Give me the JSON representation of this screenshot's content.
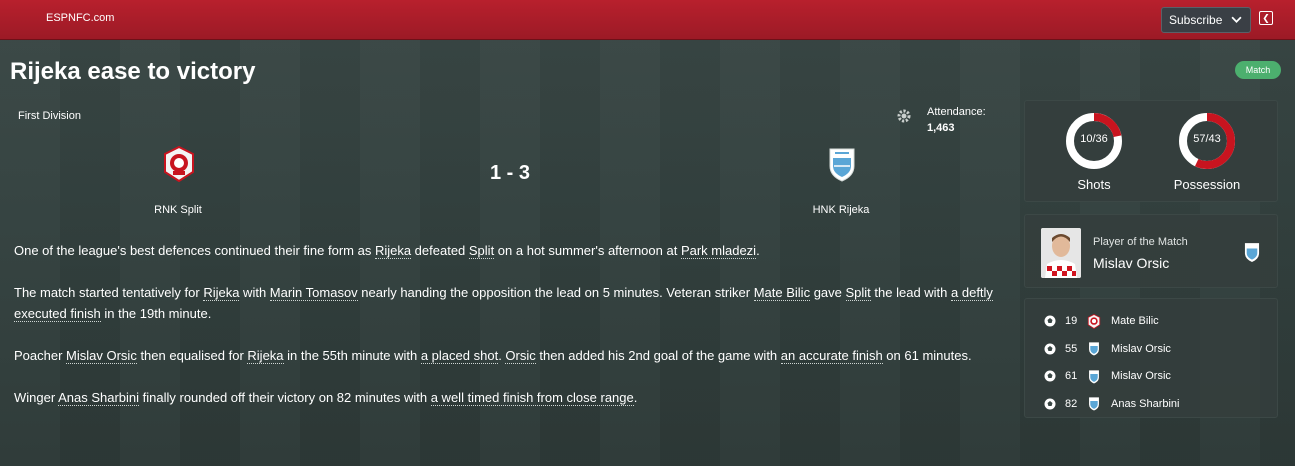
{
  "header": {
    "brand": "ESPNFC.com",
    "subscribe_label": "Subscribe"
  },
  "article": {
    "headline": "Rijeka ease to victory",
    "tag": "Match"
  },
  "match": {
    "competition": "First Division",
    "attendance_label": "Attendance:",
    "attendance": "1,463",
    "home_team": "RNK Split",
    "away_team": "HNK Rijeka",
    "score": "1 - 3"
  },
  "report": {
    "p1": [
      {
        "t": "One of the league's best defences continued their fine form as "
      },
      {
        "t": "Rijeka",
        "link": true
      },
      {
        "t": " defeated "
      },
      {
        "t": "Split",
        "link": true
      },
      {
        "t": " on a hot summer's afternoon at "
      },
      {
        "t": "Park mladezi",
        "link": true
      },
      {
        "t": "."
      }
    ],
    "p2": [
      {
        "t": "The match started tentatively for "
      },
      {
        "t": "Rijeka",
        "link": true
      },
      {
        "t": " with "
      },
      {
        "t": "Marin Tomasov",
        "link": true
      },
      {
        "t": " nearly handing the opposition the lead on 5 minutes. Veteran striker "
      },
      {
        "t": "Mate Bilic",
        "link": true
      },
      {
        "t": " gave "
      },
      {
        "t": "Split",
        "link": true
      },
      {
        "t": " the lead with "
      },
      {
        "t": "a deftly executed finish",
        "link": true
      },
      {
        "t": " in the 19th minute."
      }
    ],
    "p3": [
      {
        "t": "Poacher "
      },
      {
        "t": "Mislav Orsic",
        "link": true
      },
      {
        "t": " then equalised for "
      },
      {
        "t": "Rijeka",
        "link": true
      },
      {
        "t": " in the 55th minute with "
      },
      {
        "t": "a placed shot",
        "link": true
      },
      {
        "t": ". "
      },
      {
        "t": "Orsic",
        "link": true
      },
      {
        "t": " then added his 2nd goal of the game with "
      },
      {
        "t": "an accurate finish",
        "link": true
      },
      {
        "t": " on 61 minutes."
      }
    ],
    "p4": [
      {
        "t": "Winger "
      },
      {
        "t": "Anas Sharbini",
        "link": true
      },
      {
        "t": " finally rounded off their victory on 82 minutes with "
      },
      {
        "t": "a well timed finish from close range",
        "link": true
      },
      {
        "t": "."
      }
    ]
  },
  "stats": {
    "shots": {
      "label": "Shots",
      "value_text": "10/36",
      "home": 10,
      "away": 36
    },
    "possession": {
      "label": "Possession",
      "value_text": "57/43",
      "home": 57,
      "away": 43
    },
    "colors": {
      "home": "#c8141f",
      "away": "#ffffff"
    }
  },
  "player_of_match": {
    "label": "Player of the Match",
    "name": "Mislav Orsic"
  },
  "goals": [
    {
      "minute": "19",
      "scorer": "Mate Bilic",
      "team": "home"
    },
    {
      "minute": "55",
      "scorer": "Mislav Orsic",
      "team": "away"
    },
    {
      "minute": "61",
      "scorer": "Mislav Orsic",
      "team": "away"
    },
    {
      "minute": "82",
      "scorer": "Anas Sharbini",
      "team": "away"
    }
  ],
  "icons": {
    "settings": "gear-icon",
    "collapse": "collapse-panel-icon",
    "goal": "football-icon"
  }
}
